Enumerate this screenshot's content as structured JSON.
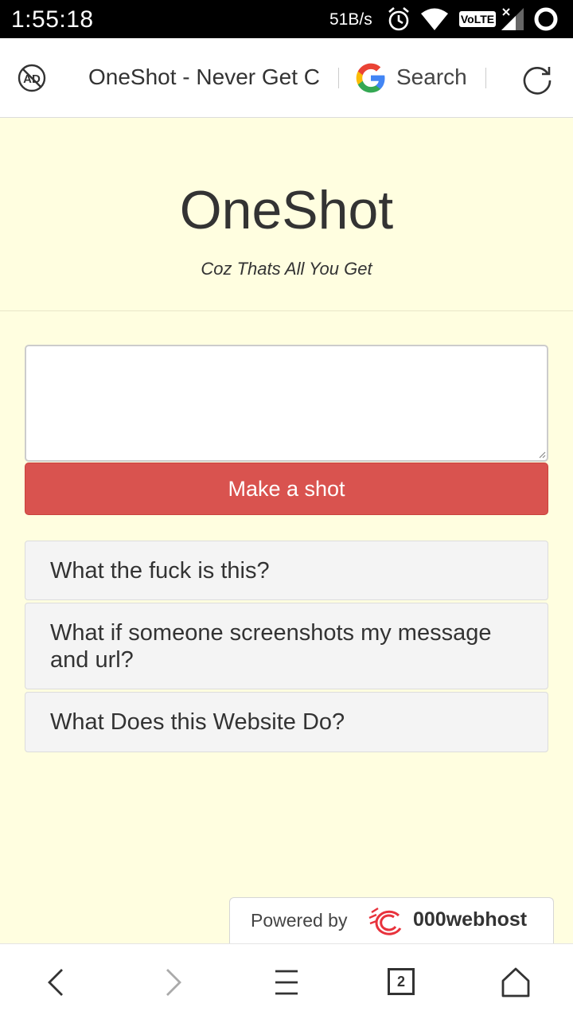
{
  "status_bar": {
    "time": "1:55:18",
    "speed": "51B/s",
    "network_label": "VoLTE",
    "icons": [
      "alarm-icon",
      "wifi-icon",
      "volte-icon",
      "signal-icon",
      "battery-icon"
    ]
  },
  "toolbar": {
    "ad_block_icon": "ad-block-icon",
    "ad_label": "AD",
    "page_title": "OneShot - Never Get C",
    "search_label": "Search",
    "refresh_icon": "refresh-icon"
  },
  "header": {
    "title": "OneShot",
    "tagline": "Coz Thats All You Get"
  },
  "form": {
    "message_value": "",
    "submit_label": "Make a shot",
    "submit_color": "#d9534f"
  },
  "faq": {
    "items": [
      "What the fuck is this?",
      "What if someone screenshots my message and url?",
      "What Does this Website Do?"
    ]
  },
  "footer": {
    "powered_by": "Powered by",
    "host_name": "000webhost"
  },
  "bottom_nav": {
    "tab_count": "2",
    "icons": [
      "back-icon",
      "forward-icon",
      "menu-icon",
      "tabs-icon",
      "home-icon"
    ]
  },
  "colors": {
    "page_background": "#fffee0",
    "button_red": "#d9534f",
    "google_blue": "#4285f4",
    "google_red": "#ea4335",
    "google_yellow": "#fbbc05",
    "google_green": "#34a853"
  }
}
